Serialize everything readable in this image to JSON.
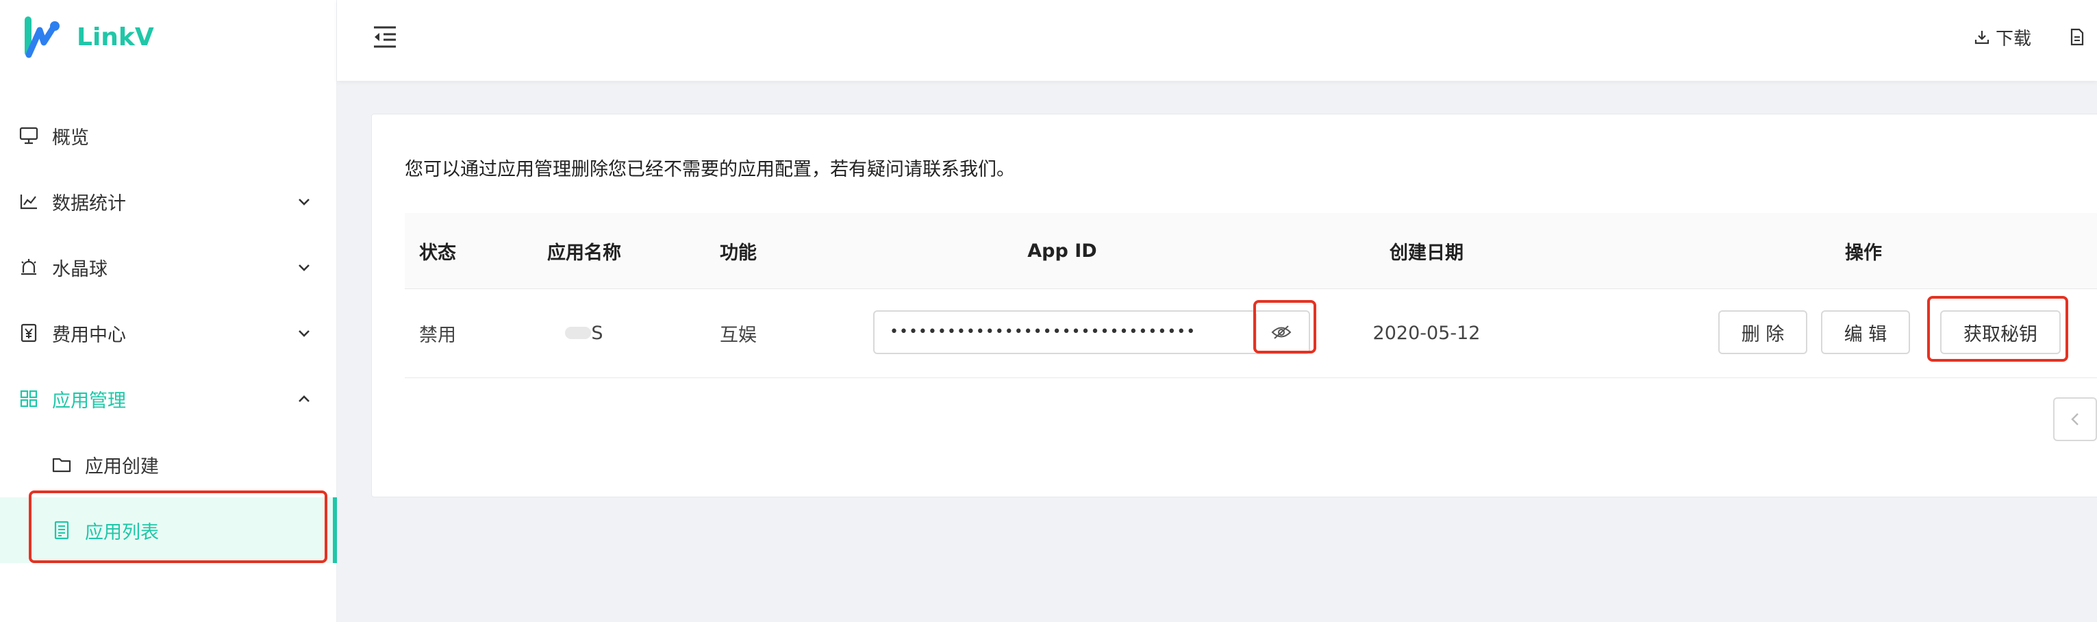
{
  "brand": {
    "name": "LinkV",
    "accent": "#1fc7a8"
  },
  "sidebar": {
    "items": [
      {
        "label": "概览",
        "icon": "monitor-icon"
      },
      {
        "label": "数据统计",
        "icon": "line-chart-icon"
      },
      {
        "label": "水晶球",
        "icon": "alarm-icon"
      },
      {
        "label": "费用中心",
        "icon": "money-icon"
      },
      {
        "label": "应用管理",
        "icon": "appstore-icon"
      },
      {
        "label": "应用创建",
        "icon": "folder-icon"
      },
      {
        "label": "应用列表",
        "icon": "list-icon"
      }
    ]
  },
  "header": {
    "download_label": "下载"
  },
  "main": {
    "notice": "您可以通过应用管理删除您已经不需要的应用配置，若有疑问请联系我们。",
    "table": {
      "columns": [
        "状态",
        "应用名称",
        "功能",
        "App ID",
        "创建日期",
        "操作"
      ],
      "rows": [
        {
          "status": "禁用",
          "name": "S",
          "feature": "互娱",
          "app_id": "••••••••••••••••••••••••••••••••",
          "created": "2020-05-12",
          "actions": {
            "delete": "删 除",
            "edit": "编 辑",
            "get_secret": "获取秘钥"
          }
        }
      ]
    }
  }
}
